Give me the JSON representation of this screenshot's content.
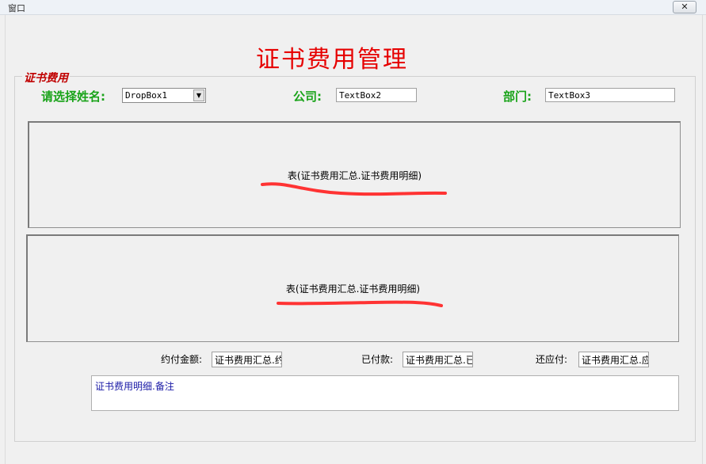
{
  "window": {
    "title": "窗口",
    "close_glyph": "✕"
  },
  "header": {
    "title": "证书费用管理"
  },
  "group": {
    "caption": "证书费用"
  },
  "fields": {
    "name_label": "请选择姓名:",
    "name_value": "DropBox1",
    "company_label": "公司:",
    "company_value": "TextBox2",
    "dept_label": "部门:",
    "dept_value": "TextBox3"
  },
  "tables": [
    {
      "text": "表(证书费用汇总.证书费用明细)"
    },
    {
      "text": "表(证书费用汇总.证书费用明细)"
    }
  ],
  "amounts": {
    "contract_label": "约付金额:",
    "contract_value": "证书费用汇总.约",
    "paid_label": "已付款:",
    "paid_value": "证书费用汇总.已",
    "due_label": "还应付:",
    "due_value": "证书费用汇总.应"
  },
  "memo": {
    "text": "证书费用明细.备注"
  },
  "annotation_color": "#ff3333"
}
